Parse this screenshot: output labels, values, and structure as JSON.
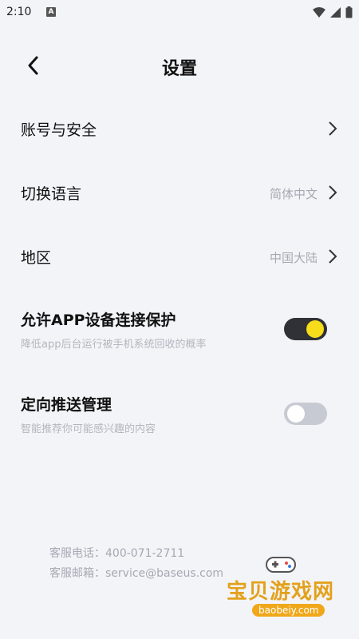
{
  "status_bar": {
    "time": "2:10",
    "notification_badge": "A"
  },
  "header": {
    "title": "设置"
  },
  "rows": [
    {
      "label": "账号与安全",
      "value": ""
    },
    {
      "label": "切换语言",
      "value": "简体中文"
    },
    {
      "label": "地区",
      "value": "中国大陆"
    }
  ],
  "toggles": [
    {
      "title": "允许APP设备连接保护",
      "subtitle": "降低app后台运行被手机系统回收的概率",
      "on": true
    },
    {
      "title": "定向推送管理",
      "subtitle": "智能推荐你可能感兴趣的内容",
      "on": false
    }
  ],
  "contact": {
    "phone": "客服电话：400-071-2711",
    "email": "客服邮箱：service@baseus.com"
  },
  "watermark": {
    "text": "宝贝游戏网",
    "url": "baobeiy.com"
  },
  "colors": {
    "background": "#f3f4f8",
    "toggle_on_track": "#2f3136",
    "toggle_on_knob": "#f6dc1a",
    "toggle_off_track": "#c7cad2",
    "secondary_text": "#a6a9b2"
  }
}
